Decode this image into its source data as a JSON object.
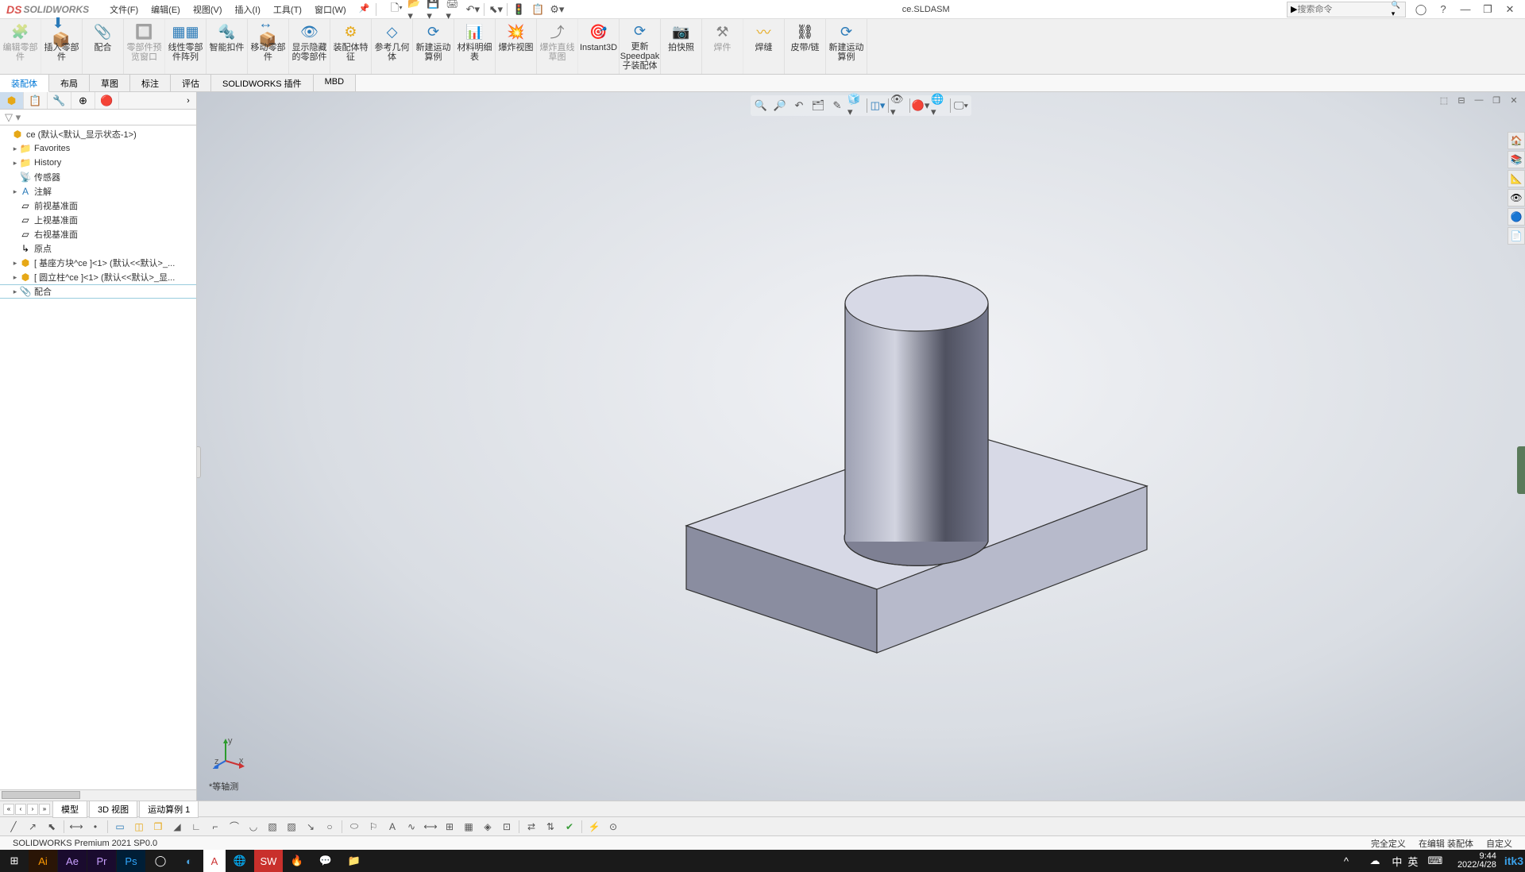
{
  "app": {
    "logo_text": "SOLIDWORKS",
    "document_title": "ce.SLDASM",
    "search_placeholder": "搜索命令"
  },
  "menu": {
    "file": "文件(F)",
    "edit": "编辑(E)",
    "view": "视图(V)",
    "insert": "插入(I)",
    "tools": "工具(T)",
    "window": "窗口(W)"
  },
  "ribbon": {
    "edit_component": "编辑零部件",
    "insert_components": "插入零部件",
    "mate": "配合",
    "preview_window": "零部件预览窗口",
    "linear_pattern": "线性零部件阵列",
    "smart_fasteners": "智能扣件",
    "move_component": "移动零部件",
    "show_hidden": "显示隐藏的零部件",
    "assembly_features": "装配体特征",
    "ref_geometry": "参考几何体",
    "new_motion": "新建运动算例",
    "bom": "材料明细表",
    "exploded_view": "爆炸视图",
    "explode_sketch": "爆炸直线草图",
    "instant3d": "Instant3D",
    "update_speedpak": "更新Speedpak子装配体",
    "snapshot": "拍快照",
    "weldment": "焊件",
    "weld_bead": "焊缝",
    "belt_chain": "皮带/链",
    "new_motion2": "新建运动算例"
  },
  "tabs": {
    "assembly": "装配体",
    "layout": "布局",
    "sketch": "草图",
    "annotate": "标注",
    "evaluate": "评估",
    "addins": "SOLIDWORKS 插件",
    "mbd": "MBD"
  },
  "tree": {
    "root": "ce  (默认<默认_显示状态-1>)",
    "favorites": "Favorites",
    "history": "History",
    "sensors": "传感器",
    "annotations": "注解",
    "front_plane": "前视基准面",
    "top_plane": "上视基准面",
    "right_plane": "右视基准面",
    "origin": "原点",
    "part1": "[ 基座方块^ce ]<1> (默认<<默认>_...",
    "part2": "[ 圆立柱^ce ]<1> (默认<<默认>_显...",
    "mates": "配合"
  },
  "viewport": {
    "orientation": "*等轴测"
  },
  "viewtabs": {
    "model": "模型",
    "view3d": "3D 视图",
    "motion1": "运动算例 1"
  },
  "status": {
    "product": "SOLIDWORKS Premium 2021 SP0.0",
    "fully_defined": "完全定义",
    "editing": "在编辑 装配体",
    "custom": "自定义"
  },
  "taskbar": {
    "time": "9:44",
    "date": "2022/4/28",
    "ime1": "中",
    "ime2": "英",
    "watermark": "itk3"
  }
}
